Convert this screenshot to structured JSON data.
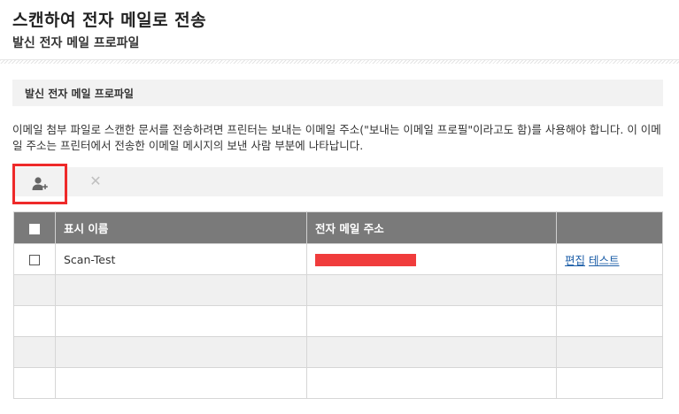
{
  "header": {
    "title": "스캔하여 전자 메일로 전송",
    "subtitle": "발신 전자 메일 프로파일"
  },
  "section": {
    "title": "발신 전자 메일 프로파일",
    "description": "이메일 첨부 파일로 스캔한 문서를 전송하려면 프린터는 보내는 이메일 주소(\"보내는 이메일 프로필\"이라고도 함)를 사용해야 합니다. 이 이메일 주소는 프린터에서 전송한 이메일 메시지의 보낸 사람 부분에 나타납니다."
  },
  "toolbar": {
    "add_icon": "add-user-icon",
    "delete_icon": "close-icon",
    "delete_glyph": "✕",
    "highlight_color": "#ee2a2a"
  },
  "table": {
    "columns": [
      "표시 이름",
      "전자 메일 주소",
      ""
    ],
    "rows": [
      {
        "display_name": "Scan-Test",
        "email_redacted": true,
        "actions": [
          "편집",
          "테스트"
        ]
      }
    ],
    "empty_rows": 4
  },
  "colors": {
    "header_bg": "#7a7a7a",
    "link": "#1e5fa8",
    "redaction": "#f03c3c"
  }
}
